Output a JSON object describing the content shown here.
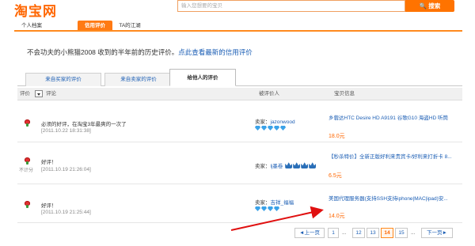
{
  "header": {
    "logo": "淘宝网",
    "search_placeholder": "输入您想要的宝贝",
    "search_button": "搜索"
  },
  "topnav": [
    "个人档案",
    "信用评价",
    "TA的江湖"
  ],
  "headline": {
    "text": "不会功夫的小熊猫2008 收到的半年前的历史评价。",
    "link": "点此查看最新的信用评价"
  },
  "subtabs": [
    "来自买家的评价",
    "来自卖家的评价",
    "给他人的评价"
  ],
  "table_header": {
    "rating": "评价",
    "comment": "评论",
    "rated": "被评价人",
    "item": "宝贝信息"
  },
  "rows": [
    {
      "comment": "必须的好评，在淘宝3年最爽的一次了",
      "date": "[2011.10.22 18:31:38]",
      "seller_prefix": "卖家：",
      "seller": "jazonwood",
      "item": "乡蓉达HTC Desire HD A9191 谷歌G10 海盗HD 听筒",
      "price": "18.0元",
      "nocount": ""
    },
    {
      "comment": "好评！",
      "date": "[2011.10.19 21:26:04]",
      "seller_prefix": "卖家：",
      "seller": "lj墨卷",
      "item": "【秒杀特价】全新正版好利来贵宾卡/好利来打折卡 8...",
      "price": "6.5元",
      "nocount": "不计分"
    },
    {
      "comment": "好评！",
      "date": "[2011.10.19 21:25:44]",
      "seller_prefix": "卖家：",
      "seller": "吉祥_福福",
      "item": "美国代理服务器(支持SSH支持iphone|MAC|ipad)安...",
      "price": "14.0元",
      "nocount": ""
    }
  ],
  "pager": {
    "prev": "◄上一页",
    "pages": [
      "1",
      "...",
      "12",
      "13",
      "14",
      "15",
      "..."
    ],
    "current": "14",
    "next": "下一页►"
  }
}
